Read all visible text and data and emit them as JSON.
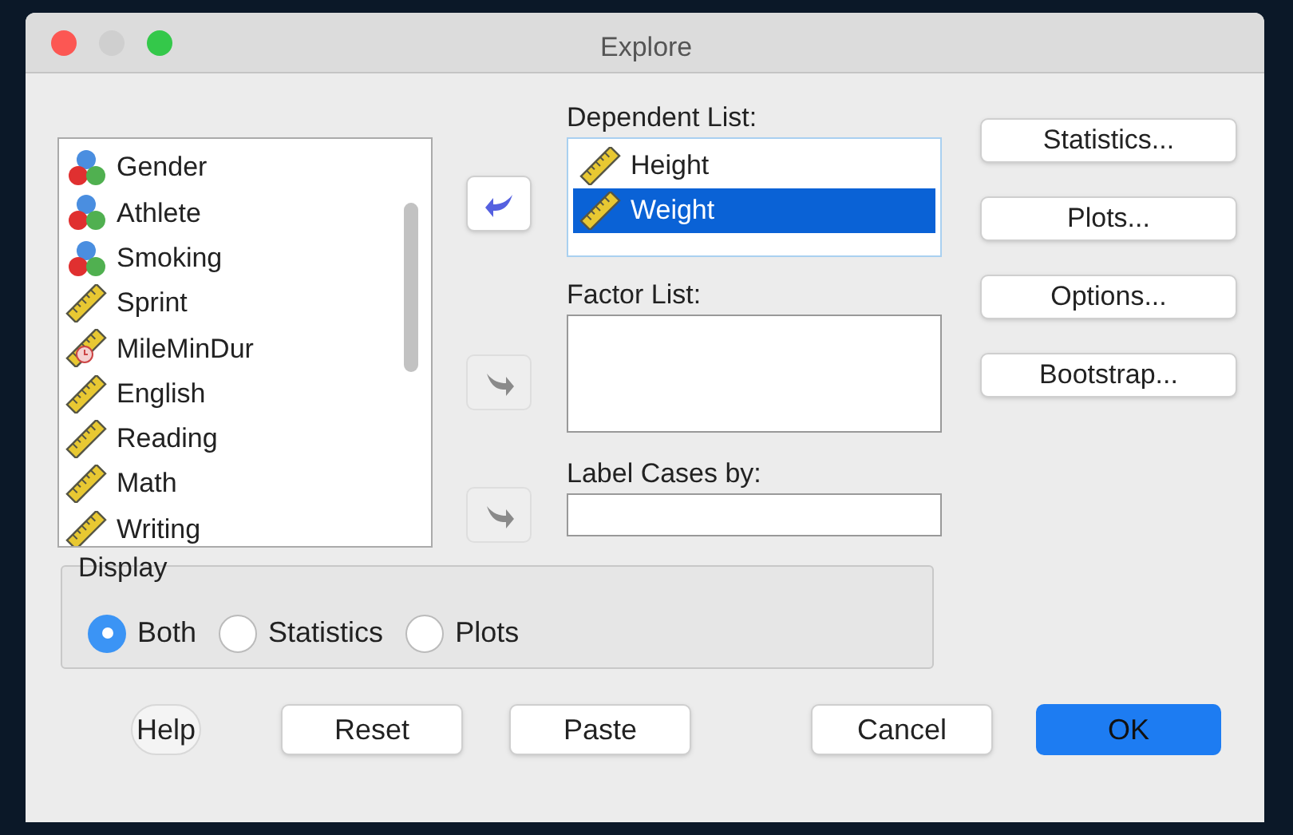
{
  "window": {
    "title": "Explore"
  },
  "variables": [
    {
      "name": "Gender",
      "kind": "nominal"
    },
    {
      "name": "Athlete",
      "kind": "nominal"
    },
    {
      "name": "Smoking",
      "kind": "nominal"
    },
    {
      "name": "Sprint",
      "kind": "scale"
    },
    {
      "name": "MileMinDur",
      "kind": "duration"
    },
    {
      "name": "English",
      "kind": "scale"
    },
    {
      "name": "Reading",
      "kind": "scale"
    },
    {
      "name": "Math",
      "kind": "scale"
    },
    {
      "name": "Writing",
      "kind": "scale"
    }
  ],
  "move_buttons": [
    {
      "disabled": false
    },
    {
      "disabled": true
    },
    {
      "disabled": true
    }
  ],
  "dependent_list": {
    "label": "Dependent List:",
    "items": [
      {
        "name": "Height",
        "kind": "scale",
        "selected": false
      },
      {
        "name": "Weight",
        "kind": "scale",
        "selected": true
      }
    ]
  },
  "factor_list": {
    "label": "Factor List:"
  },
  "label_cases": {
    "label": "Label Cases by:"
  },
  "side_buttons": [
    "Statistics...",
    "Plots...",
    "Options...",
    "Bootstrap..."
  ],
  "display": {
    "title": "Display",
    "options": [
      {
        "label": "Both",
        "selected": true
      },
      {
        "label": "Statistics",
        "selected": false
      },
      {
        "label": "Plots",
        "selected": false
      }
    ]
  },
  "footer_buttons": [
    {
      "label": "Help",
      "kind": "help"
    },
    {
      "label": "Reset",
      "kind": "normal"
    },
    {
      "label": "Paste",
      "kind": "normal"
    },
    {
      "label": "Cancel",
      "kind": "normal"
    },
    {
      "label": "OK",
      "kind": "default"
    }
  ]
}
